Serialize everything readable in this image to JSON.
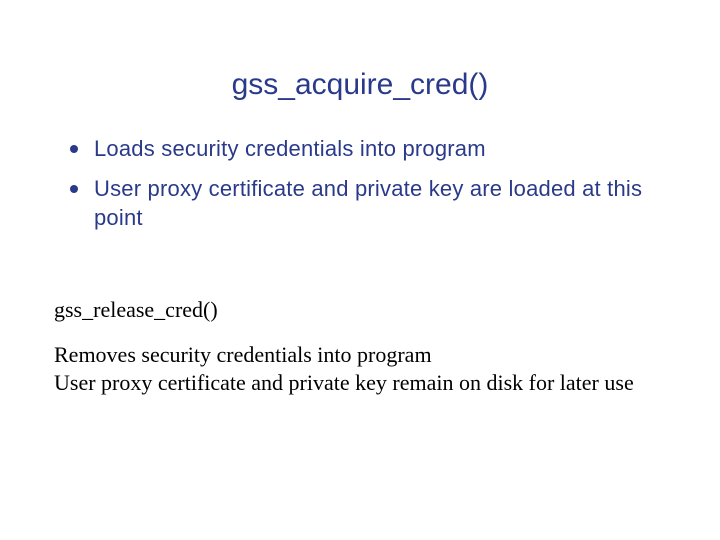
{
  "title": "gss_acquire_cred()",
  "bullets": [
    "Loads security credentials into program",
    "User proxy certificate and private key are loaded at this point"
  ],
  "subhead": "gss_release_cred()",
  "body_lines": [
    "Removes security credentials into program",
    "User proxy certificate and private key remain on disk for later use"
  ]
}
